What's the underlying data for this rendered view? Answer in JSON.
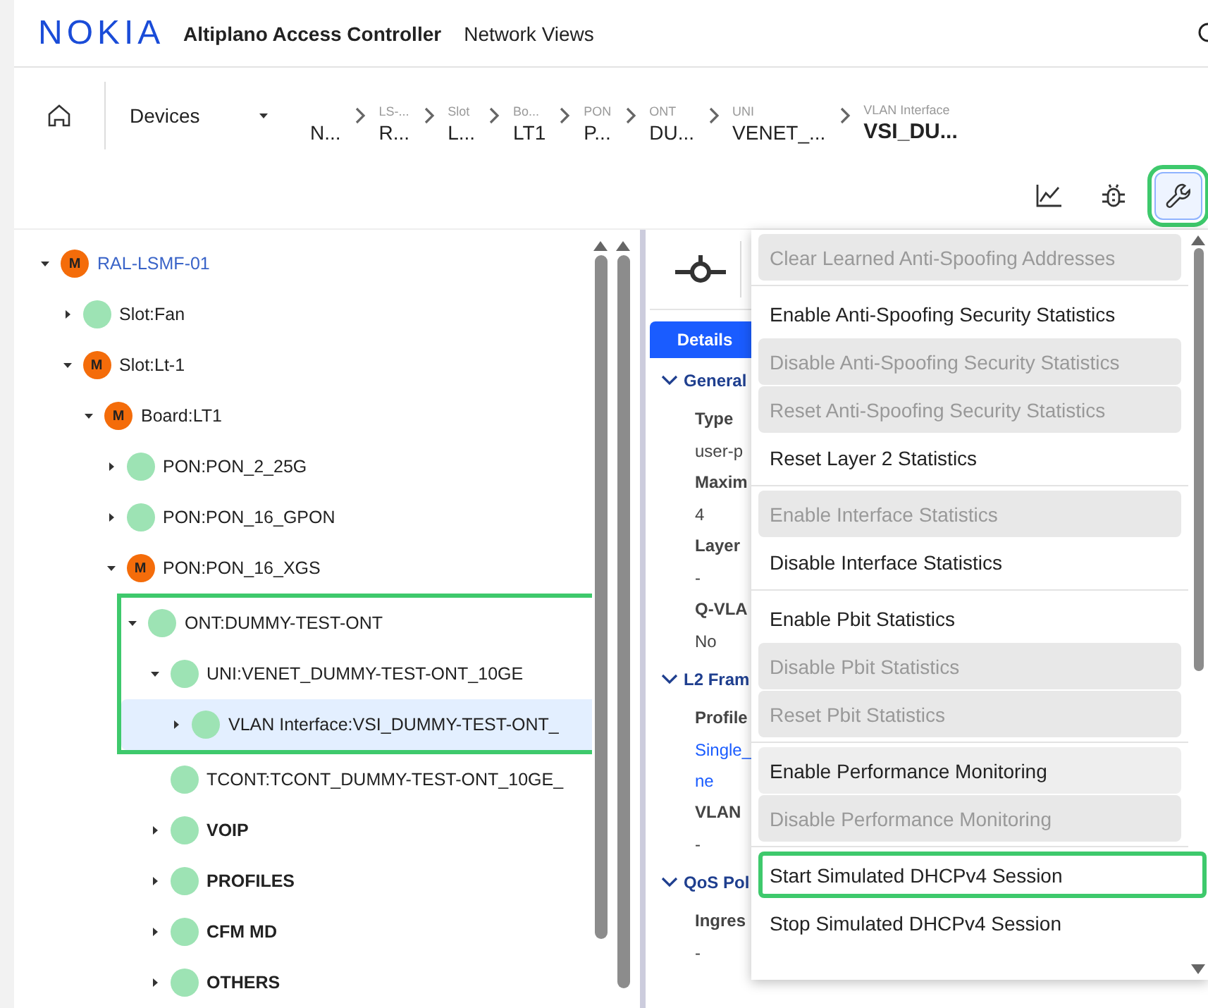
{
  "header": {
    "logo": "NOKIA",
    "app_title": "Altiplano Access Controller",
    "nav_link": "Network Views"
  },
  "breadcrumb": {
    "dropdown": "Devices",
    "crumbs": [
      {
        "label": "N...",
        "current": false
      },
      {
        "caption": "LS-...",
        "label": "R...",
        "current": false
      },
      {
        "caption": "Slot",
        "label": "L...",
        "current": false
      },
      {
        "caption": "Bo...",
        "label": "LT1",
        "current": false
      },
      {
        "caption": "PON",
        "label": "P...",
        "current": false
      },
      {
        "caption": "ONT",
        "label": "DU...",
        "current": false
      },
      {
        "caption": "UNI",
        "label": "VENET_...",
        "current": false
      },
      {
        "caption": "VLAN Interface",
        "label": "VSI_DU...",
        "current": true
      }
    ]
  },
  "toolbar": [
    {
      "kind": "chart",
      "selected": false,
      "highlighted": false
    },
    {
      "kind": "bug",
      "selected": false,
      "highlighted": false
    },
    {
      "kind": "wrench",
      "selected": true,
      "highlighted": true
    }
  ],
  "tree": [
    {
      "kind": "root",
      "label": "RAL-LSMF-01",
      "badge": "M",
      "color": "#f46c0a",
      "expanded": true,
      "selected": false,
      "highlighted": false,
      "children": [
        {
          "kind": "object",
          "label": "Slot:Fan",
          "color": "#9de3b4",
          "expanded": false,
          "selected": false,
          "highlighted": false
        },
        {
          "kind": "object",
          "label": "Slot:Lt-1",
          "badge": "M",
          "color": "#f46c0a",
          "expanded": true,
          "selected": false,
          "highlighted": false,
          "children": [
            {
              "kind": "object",
              "label": "Board:LT1",
              "badge": "M",
              "color": "#f46c0a",
              "expanded": true,
              "selected": false,
              "highlighted": false,
              "children": [
                {
                  "kind": "object",
                  "label": "PON:PON_2_25G",
                  "color": "#9de3b4",
                  "expanded": false,
                  "selected": false,
                  "highlighted": false
                },
                {
                  "kind": "object",
                  "label": "PON:PON_16_GPON",
                  "color": "#9de3b4",
                  "expanded": false,
                  "selected": false,
                  "highlighted": false
                },
                {
                  "kind": "object",
                  "label": "PON:PON_16_XGS",
                  "badge": "M",
                  "color": "#f46c0a",
                  "expanded": true,
                  "selected": false,
                  "highlighted": false,
                  "children": [
                    {
                      "kind": "object",
                      "label": "ONT:DUMMY-TEST-ONT",
                      "color": "#9de3b4",
                      "expanded": true,
                      "selected": false,
                      "highlighted": true,
                      "children": [
                        {
                          "kind": "object",
                          "label": "UNI:VENET_DUMMY-TEST-ONT_10GE",
                          "color": "#9de3b4",
                          "expanded": true,
                          "selected": false,
                          "highlighted": true,
                          "children": [
                            {
                              "kind": "object",
                              "label": "VLAN Interface:VSI_DUMMY-TEST-ONT_",
                              "color": "#9de3b4",
                              "expanded": false,
                              "selected": true,
                              "highlighted": true
                            }
                          ]
                        },
                        {
                          "kind": "object",
                          "label": "TCONT:TCONT_DUMMY-TEST-ONT_10GE_",
                          "color": "#9de3b4",
                          "selected": false,
                          "highlighted": false
                        },
                        {
                          "kind": "folder",
                          "label": "VOIP",
                          "color": "#9de3b4",
                          "expanded": false,
                          "selected": false,
                          "highlighted": false
                        },
                        {
                          "kind": "folder",
                          "label": "PROFILES",
                          "color": "#9de3b4",
                          "expanded": false,
                          "selected": false,
                          "highlighted": false
                        },
                        {
                          "kind": "folder",
                          "label": "CFM MD",
                          "color": "#9de3b4",
                          "expanded": false,
                          "selected": false,
                          "highlighted": false
                        },
                        {
                          "kind": "folder",
                          "label": "OTHERS",
                          "color": "#9de3b4",
                          "expanded": false,
                          "selected": false,
                          "highlighted": false
                        }
                      ]
                    }
                  ]
                }
              ]
            }
          ]
        }
      ]
    }
  ],
  "details": {
    "tab": "Details",
    "sections": [
      {
        "title": "General",
        "fields": [
          {
            "label": "Type",
            "value": "user-p"
          },
          {
            "label": "Maxim",
            "value": "4"
          },
          {
            "label": "Layer",
            "value": "-"
          },
          {
            "label": "Q-VLA",
            "value": "No"
          }
        ]
      },
      {
        "title": "L2 Fram",
        "fields": [
          {
            "label": "Profile",
            "value": "Single_",
            "value_2": "ne",
            "link": true
          },
          {
            "label": "VLAN",
            "value": "-"
          }
        ]
      },
      {
        "title": "QoS Pol",
        "fields": [
          {
            "label": "Ingres",
            "value": "-"
          }
        ]
      }
    ]
  },
  "menu": {
    "groups": [
      [
        {
          "label": "Clear Learned Anti-Spoofing Addresses",
          "disabled": true,
          "hovered": false,
          "highlighted": false
        }
      ],
      [
        {
          "label": "Enable Anti-Spoofing Security Statistics",
          "disabled": false,
          "hovered": false,
          "highlighted": false
        },
        {
          "label": "Disable Anti-Spoofing Security Statistics",
          "disabled": true,
          "hovered": false,
          "highlighted": false
        },
        {
          "label": "Reset Anti-Spoofing Security Statistics",
          "disabled": true,
          "hovered": false,
          "highlighted": false
        },
        {
          "label": "Reset Layer 2 Statistics",
          "disabled": false,
          "hovered": false,
          "highlighted": false
        }
      ],
      [
        {
          "label": "Enable Interface Statistics",
          "disabled": true,
          "hovered": false,
          "highlighted": false
        },
        {
          "label": "Disable Interface Statistics",
          "disabled": false,
          "hovered": false,
          "highlighted": false
        }
      ],
      [
        {
          "label": "Enable Pbit Statistics",
          "disabled": false,
          "hovered": false,
          "highlighted": false
        },
        {
          "label": "Disable Pbit Statistics",
          "disabled": true,
          "hovered": false,
          "highlighted": false
        },
        {
          "label": "Reset Pbit Statistics",
          "disabled": true,
          "hovered": false,
          "highlighted": false
        }
      ],
      [
        {
          "label": "Enable Performance Monitoring",
          "disabled": false,
          "hovered": true,
          "highlighted": false
        },
        {
          "label": "Disable Performance Monitoring",
          "disabled": true,
          "hovered": false,
          "highlighted": false
        }
      ],
      [
        {
          "label": "Start Simulated DHCPv4 Session",
          "disabled": false,
          "hovered": false,
          "highlighted": true
        },
        {
          "label": "Stop Simulated DHCPv4 Session",
          "disabled": false,
          "hovered": false,
          "highlighted": false
        }
      ]
    ]
  }
}
